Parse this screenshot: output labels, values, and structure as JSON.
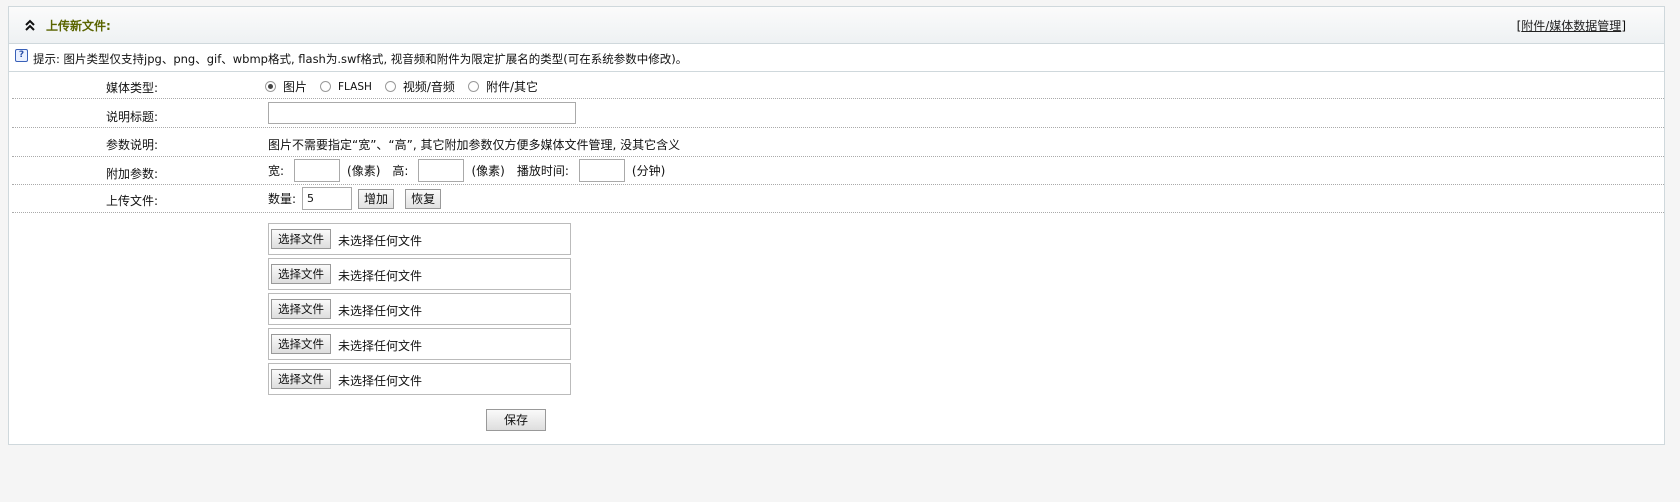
{
  "header": {
    "title": "上传新文件:",
    "link_open": "[",
    "link_text": "附件/媒体数据管理",
    "link_close": "]"
  },
  "hint": {
    "text": "提示: 图片类型仅支持jpg、png、gif、wbmp格式, flash为.swf格式, 视音频和附件为限定扩展名的类型(可在系统参数中修改)。"
  },
  "media_type": {
    "label": "媒体类型:",
    "options": [
      "图片",
      "FLASH",
      "视频/音频",
      "附件/其它"
    ],
    "selected": "图片"
  },
  "title_field": {
    "label": "说明标题:",
    "value": ""
  },
  "param_desc": {
    "label": "参数说明:",
    "text": "图片不需要指定“宽”、“高”, 其它附加参数仅方便多媒体文件管理, 没其它含义"
  },
  "extra_params": {
    "label": "附加参数:",
    "width_label": "宽:",
    "width_unit": "(像素)",
    "height_label": "高:",
    "height_unit": "(像素)",
    "time_label": "播放时间:",
    "time_unit": "(分钟)"
  },
  "upload": {
    "label": "上传文件:",
    "count_label": "数量:",
    "count_value": "5",
    "add_label": "增加",
    "reset_label": "恢复"
  },
  "files": [
    {
      "button": "选择文件",
      "status": "未选择任何文件"
    },
    {
      "button": "选择文件",
      "status": "未选择任何文件"
    },
    {
      "button": "选择文件",
      "status": "未选择任何文件"
    },
    {
      "button": "选择文件",
      "status": "未选择任何文件"
    },
    {
      "button": "选择文件",
      "status": "未选择任何文件"
    }
  ],
  "save_label": "保存"
}
